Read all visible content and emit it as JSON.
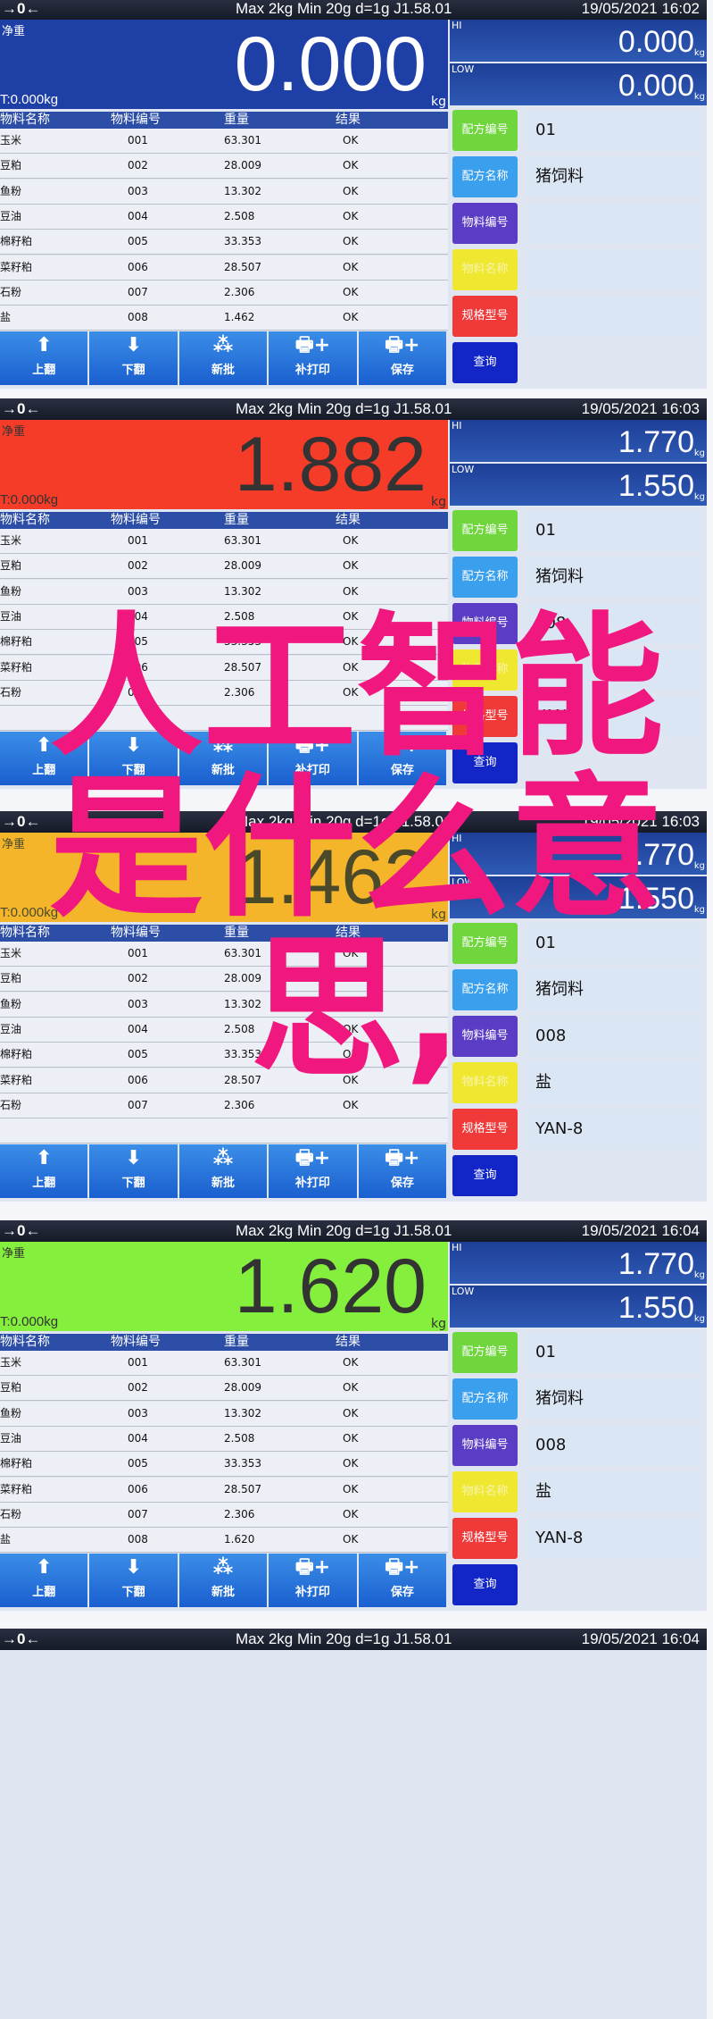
{
  "common": {
    "zero_icon": "zero-tare-icon",
    "spec": "Max 2kg  Min 20g  d=1g    J1.58.01",
    "net_label": "净重",
    "tare": "T:0.000kg",
    "unit": "kg",
    "hi_label": "HI",
    "low_label": "LOW",
    "columns": [
      "物料名称",
      "物料编号",
      "重量",
      "结果"
    ],
    "buttons": [
      {
        "label": "上翻",
        "icon": "arrow-up-icon"
      },
      {
        "label": "下翻",
        "icon": "arrow-down-icon"
      },
      {
        "label": "新批",
        "icon": "stack-icon"
      },
      {
        "label": "补打印",
        "icon": "printer-plus-icon"
      },
      {
        "label": "保存",
        "icon": "printer-plus-icon"
      }
    ],
    "side_buttons": [
      {
        "label": "配方编号",
        "color": "#6fd63e"
      },
      {
        "label": "配方名称",
        "color": "#3aa0ee"
      },
      {
        "label": "物料编号",
        "color": "#5a3dc4"
      },
      {
        "label": "物料名称",
        "color": "#f0e830"
      },
      {
        "label": "规格型号",
        "color": "#f03a3a"
      },
      {
        "label": "查询",
        "color": "#1226c8"
      }
    ]
  },
  "panels": [
    {
      "datetime": "19/05/2021  16:02",
      "value": "0.000",
      "display_color": "#1d3fa6",
      "value_color": "#ffffff",
      "hi": "0.000",
      "low": "0.000",
      "rows": [
        [
          "玉米",
          "001",
          "63.301",
          "OK"
        ],
        [
          "豆粕",
          "002",
          "28.009",
          "OK"
        ],
        [
          "鱼粉",
          "003",
          "13.302",
          "OK"
        ],
        [
          "豆油",
          "004",
          "2.508",
          "OK"
        ],
        [
          "棉籽粕",
          "005",
          "33.353",
          "OK"
        ],
        [
          "菜籽粕",
          "006",
          "28.507",
          "OK"
        ],
        [
          "石粉",
          "007",
          "2.306",
          "OK"
        ],
        [
          "盐",
          "008",
          "1.462",
          "OK"
        ]
      ],
      "info": [
        "01",
        "猪饲料",
        "",
        "",
        "",
        ""
      ]
    },
    {
      "datetime": "19/05/2021  16:03",
      "value": "1.882",
      "display_color": "#f43c28",
      "value_color": "#333333",
      "hi": "1.770",
      "low": "1.550",
      "rows": [
        [
          "玉米",
          "001",
          "63.301",
          "OK"
        ],
        [
          "豆粕",
          "002",
          "28.009",
          "OK"
        ],
        [
          "鱼粉",
          "003",
          "13.302",
          "OK"
        ],
        [
          "豆油",
          "004",
          "2.508",
          "OK"
        ],
        [
          "棉籽粕",
          "005",
          "33.353",
          "OK"
        ],
        [
          "菜籽粕",
          "006",
          "28.507",
          "OK"
        ],
        [
          "石粉",
          "007",
          "2.306",
          "OK"
        ]
      ],
      "info": [
        "01",
        "猪饲料",
        "008",
        "",
        "YAN-8",
        ""
      ]
    },
    {
      "datetime": "19/05/2021  16:03",
      "value": "1.462",
      "display_color": "#f5b52a",
      "value_color": "#4a4a2a",
      "hi": "1.770",
      "low": "1.550",
      "rows": [
        [
          "玉米",
          "001",
          "63.301",
          "OK"
        ],
        [
          "豆粕",
          "002",
          "28.009",
          "OK"
        ],
        [
          "鱼粉",
          "003",
          "13.302",
          "OK"
        ],
        [
          "豆油",
          "004",
          "2.508",
          "OK"
        ],
        [
          "棉籽粕",
          "005",
          "33.353",
          "OK"
        ],
        [
          "菜籽粕",
          "006",
          "28.507",
          "OK"
        ],
        [
          "石粉",
          "007",
          "2.306",
          "OK"
        ]
      ],
      "info": [
        "01",
        "猪饲料",
        "008",
        "盐",
        "YAN-8",
        ""
      ]
    },
    {
      "datetime": "19/05/2021  16:04",
      "value": "1.620",
      "display_color": "#84ef3c",
      "value_color": "#333333",
      "hi": "1.770",
      "low": "1.550",
      "rows": [
        [
          "玉米",
          "001",
          "63.301",
          "OK"
        ],
        [
          "豆粕",
          "002",
          "28.009",
          "OK"
        ],
        [
          "鱼粉",
          "003",
          "13.302",
          "OK"
        ],
        [
          "豆油",
          "004",
          "2.508",
          "OK"
        ],
        [
          "棉籽粕",
          "005",
          "33.353",
          "OK"
        ],
        [
          "菜籽粕",
          "006",
          "28.507",
          "OK"
        ],
        [
          "石粉",
          "007",
          "2.306",
          "OK"
        ],
        [
          "盐",
          "008",
          "1.620",
          "OK"
        ]
      ],
      "info": [
        "01",
        "猪饲料",
        "008",
        "盐",
        "YAN-8",
        ""
      ]
    },
    {
      "datetime": "19/05/2021  16:04"
    }
  ],
  "overlay_text": {
    "line1": "人工智能",
    "line2": "是什么意",
    "line3": "思,"
  }
}
